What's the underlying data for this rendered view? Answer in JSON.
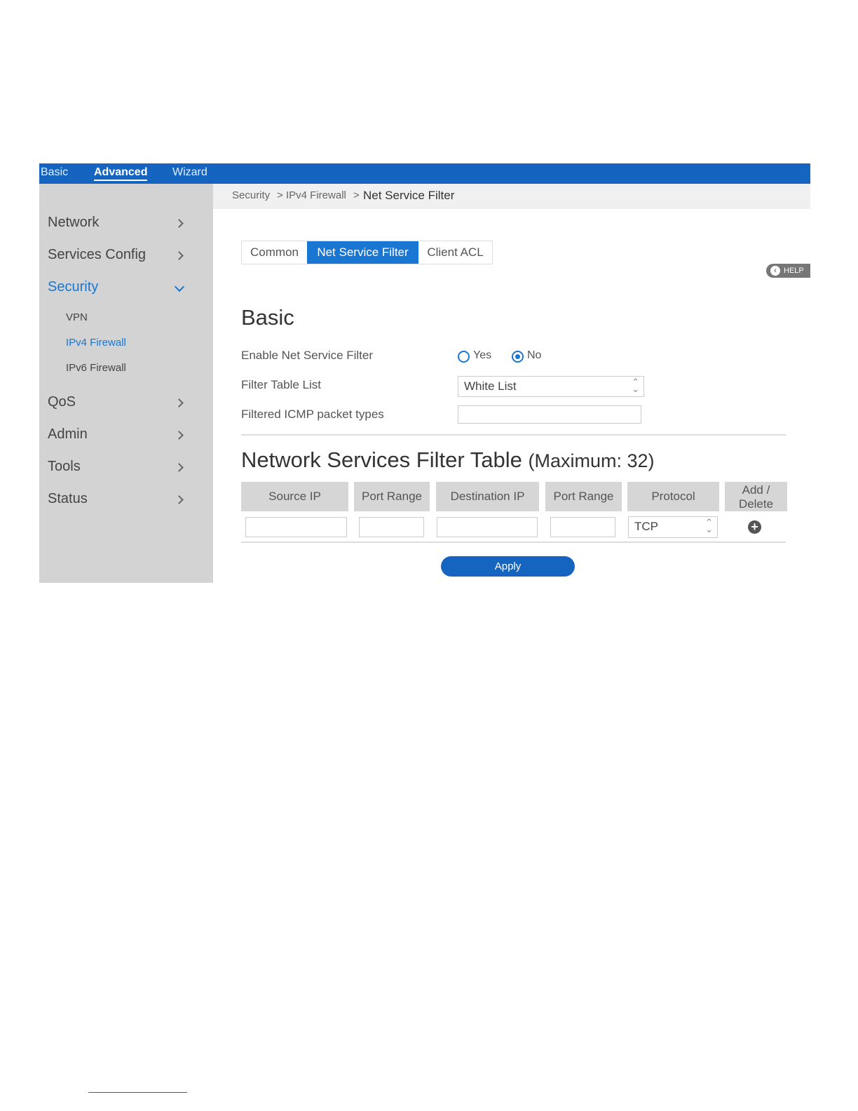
{
  "top_nav": {
    "basic": "Basic",
    "advanced": "Advanced",
    "wizard": "Wizard"
  },
  "sidebar": {
    "items": [
      {
        "label": "Network"
      },
      {
        "label": "Services Config"
      },
      {
        "label": "Security"
      },
      {
        "label": "QoS"
      },
      {
        "label": "Admin"
      },
      {
        "label": "Tools"
      },
      {
        "label": "Status"
      }
    ],
    "security_sub": [
      {
        "label": "VPN"
      },
      {
        "label": "IPv4 Firewall"
      },
      {
        "label": "IPv6 Firewall"
      }
    ]
  },
  "breadcrumb": {
    "part1": "Security",
    "sep": ">",
    "part2": "IPv4 Firewall",
    "current": "Net Service Filter"
  },
  "tabs": [
    {
      "label": "Common"
    },
    {
      "label": "Net Service Filter"
    },
    {
      "label": "Client ACL"
    }
  ],
  "help_label": "HELP",
  "basic": {
    "heading": "Basic",
    "enable_label": "Enable Net Service Filter",
    "yes_label": "Yes",
    "no_label": "No",
    "enable_value": "No",
    "filter_table_label": "Filter Table List",
    "filter_table_value": "White List",
    "icmp_label": "Filtered ICMP packet types",
    "icmp_value": ""
  },
  "table": {
    "heading": "Network Services Filter Table",
    "maximum": "(Maximum: 32)",
    "columns": [
      "Source IP",
      "Port Range",
      "Destination IP",
      "Port Range",
      "Protocol",
      "Add /",
      "Delete"
    ],
    "row": {
      "source_ip": "",
      "port_range_1": "",
      "destination_ip": "",
      "port_range_2": "",
      "protocol": "TCP"
    }
  },
  "apply_label": "Apply",
  "colors": {
    "brand": "#1565c0",
    "accent": "#1976d2",
    "sidebar_bg": "#d3d3d3"
  },
  "icons": {
    "chevron_right": "chevron-right-icon",
    "chevron_down": "chevron-down-icon",
    "help": "help-icon",
    "add": "plus-circle-icon"
  }
}
